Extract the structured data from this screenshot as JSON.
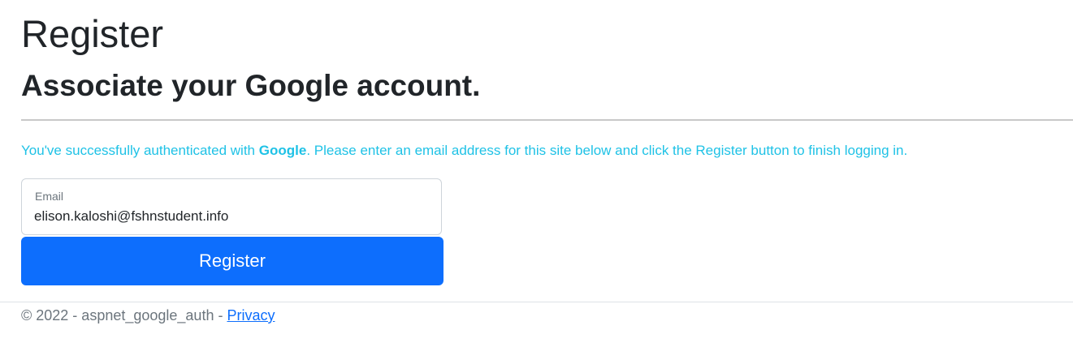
{
  "page": {
    "title": "Register",
    "subtitle": "Associate your Google account.",
    "info": {
      "prefix": "You've successfully authenticated with ",
      "provider": "Google",
      "suffix": ". Please enter an email address for this site below and click the Register button to finish logging in."
    },
    "form": {
      "email_label": "Email",
      "email_value": "elison.kaloshi@fshnstudent.info",
      "submit_label": "Register"
    }
  },
  "footer": {
    "text": "© 2022 - aspnet_google_auth - ",
    "privacy_link": "Privacy"
  },
  "colors": {
    "primary": "#0d6efd",
    "info": "#1fc2e6"
  }
}
